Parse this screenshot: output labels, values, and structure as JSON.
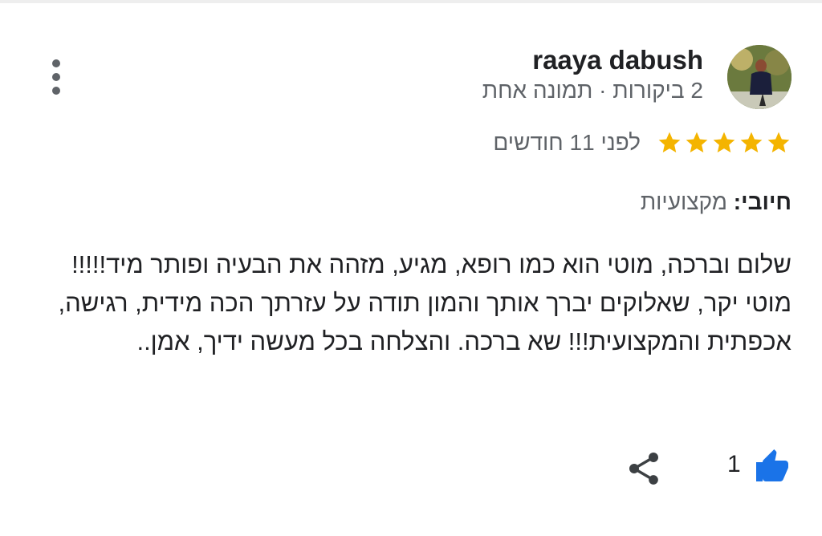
{
  "review": {
    "author": {
      "name": "raaya dabush",
      "meta": "2 ביקורות · תמונה אחת",
      "avatar_icon": "profile-photo"
    },
    "rating": {
      "stars": 5,
      "max_stars": 5,
      "star_color": "#f4b400",
      "time_ago": "לפני 11 חודשים"
    },
    "positive": {
      "label": "חיובי:",
      "value": "מקצועיות"
    },
    "text": "שלום וברכה, מוטי הוא כמו רופא, מגיע, מזהה את הבעיה ופותר מיד!!!!! מוטי יקר, שאלוקים יברך אותך והמון תודה על עזרתך הכה מידית, רגישה, אכפתית והמקצועית!!! שא ברכה. והצלחה בכל מעשה ידיך, אמן..",
    "actions": {
      "like_count": "1",
      "like_icon": "thumb-up-icon",
      "share_icon": "share-icon",
      "more_icon": "more-vert-icon",
      "accent_color": "#1a73e8"
    }
  }
}
